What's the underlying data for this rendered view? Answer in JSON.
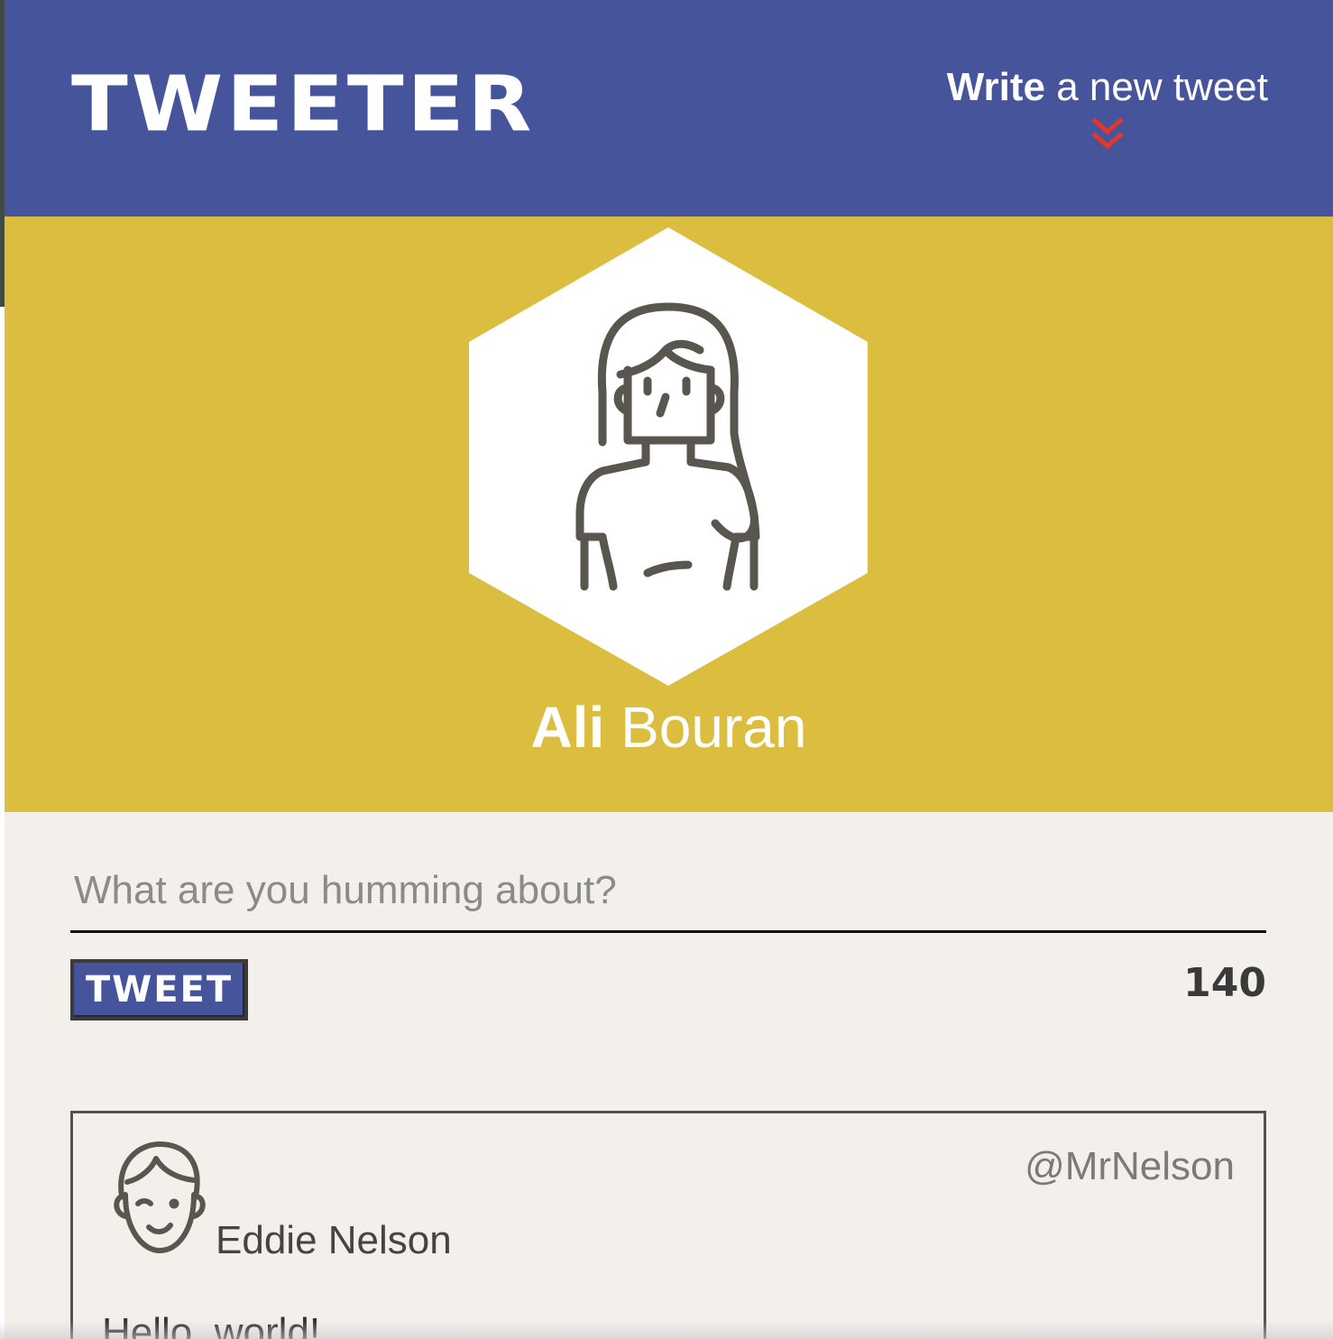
{
  "nav": {
    "logo": "TWEETER",
    "write_bold": "Write",
    "write_rest": " a new tweet",
    "toggle_icon": "double-chevron-down-icon",
    "accent_color": "#e0382b"
  },
  "profile": {
    "first_name": "Ali",
    "last_name": " Bouran",
    "avatar_icon": "woman-avatar-icon",
    "background_color": "#dbbd3f"
  },
  "compose": {
    "placeholder": "What are you humming about?",
    "button_label": "TWEET",
    "char_count": "140"
  },
  "tweets": [
    {
      "name": "Eddie Nelson",
      "handle": "@MrNelson",
      "content": "Hello, world!",
      "avatar_icon": "man-avatar-icon"
    }
  ],
  "colors": {
    "header": "#46559b",
    "page": "#f3f0eb"
  }
}
